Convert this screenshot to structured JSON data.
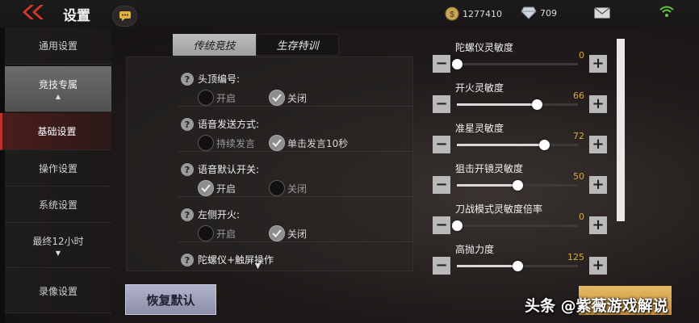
{
  "header": {
    "title": "设置",
    "coins": "1277410",
    "diamonds": "709"
  },
  "sidebar": {
    "items": [
      {
        "label": "通用设置"
      },
      {
        "label": "竞技专属"
      },
      {
        "label": "基础设置"
      },
      {
        "label": "操作设置"
      },
      {
        "label": "系统设置"
      },
      {
        "label": "最终12小时"
      },
      {
        "label": "录像设置"
      }
    ]
  },
  "tabs": [
    {
      "label": "传统竞技"
    },
    {
      "label": "生存特训"
    }
  ],
  "settings": [
    {
      "label": "头顶编号:",
      "options": [
        "开启",
        "关闭"
      ],
      "selected": 1
    },
    {
      "label": "语音发送方式:",
      "options": [
        "持续发言",
        "单击发言10秒"
      ],
      "selected": 1
    },
    {
      "label": "语音默认开关:",
      "options": [
        "开启",
        "关闭"
      ],
      "selected": 0
    },
    {
      "label": "左侧开火:",
      "options": [
        "开启",
        "关闭"
      ],
      "selected": 1
    },
    {
      "label": "陀螺仪+触屏操作",
      "options": [],
      "selected": null
    }
  ],
  "sensitivity": [
    {
      "label": "陀螺仪灵敏度",
      "value": "0",
      "level": 0
    },
    {
      "label": "开火灵敏度",
      "value": "66",
      "level": 0.66
    },
    {
      "label": "准星灵敏度",
      "value": "72",
      "level": 0.72
    },
    {
      "label": "狙击开镜灵敏度",
      "value": "50",
      "level": 0.5
    },
    {
      "label": "刀战模式灵敏度倍率",
      "value": "0",
      "level": 0
    },
    {
      "label": "高抛力度",
      "value": "125",
      "level": 0.5
    }
  ],
  "buttons": {
    "restore_default": "恢复默认"
  },
  "watermark": "头条 @紫薇游戏解说",
  "colors": {
    "accent_red": "#c0312a",
    "value_gold": "#d7a845",
    "tab_active": "#b0b0b0"
  }
}
